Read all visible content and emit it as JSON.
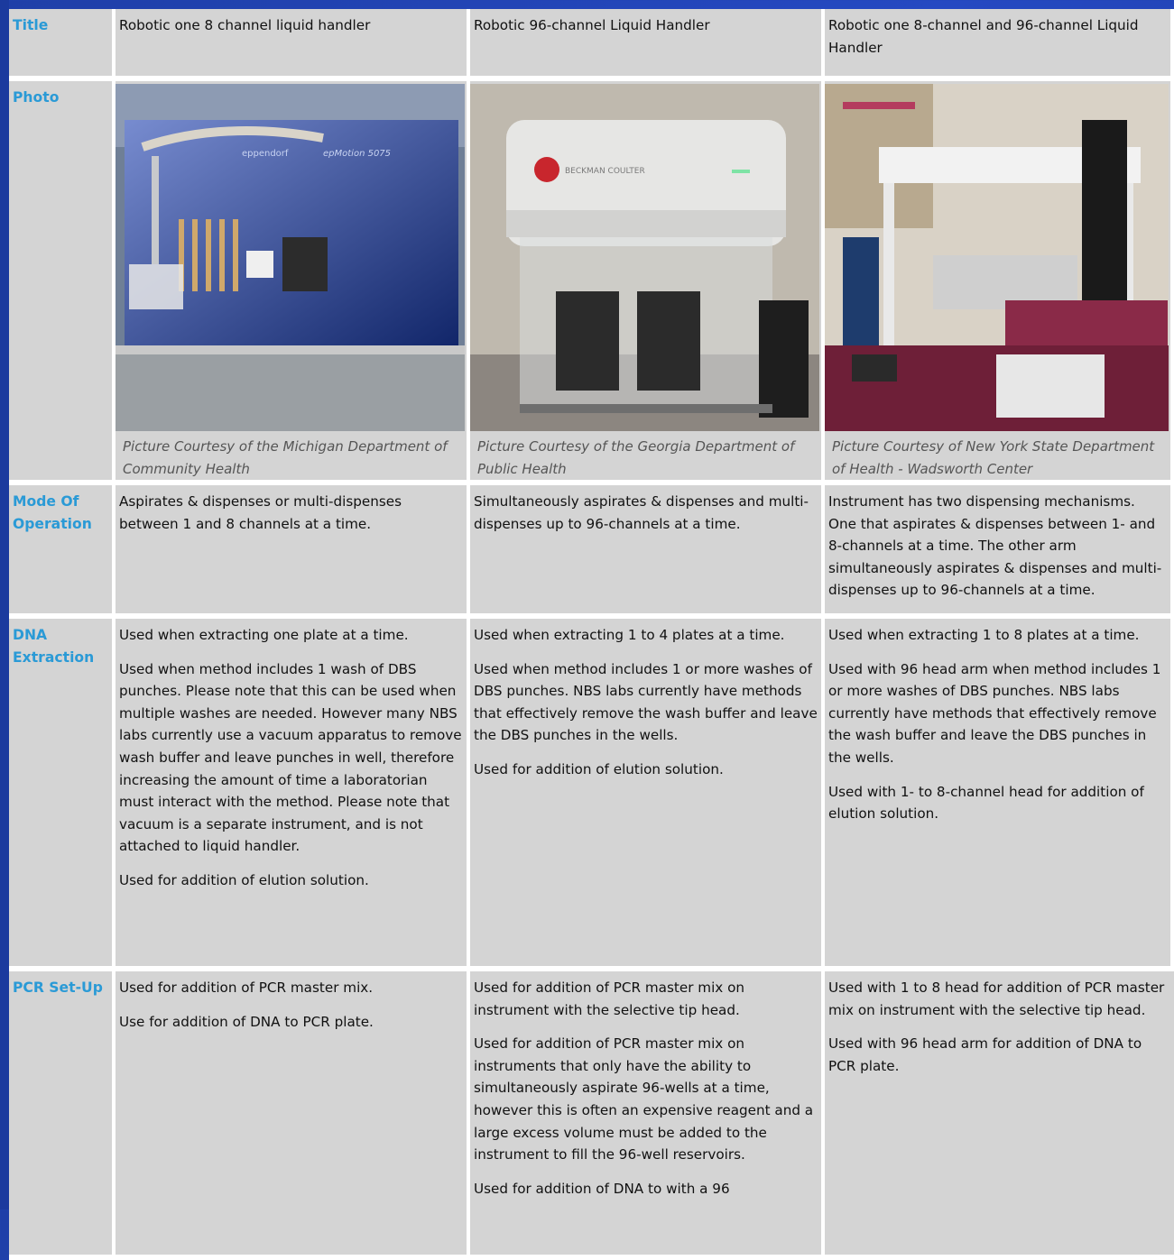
{
  "headers": {
    "title": "Title",
    "photo": "Photo",
    "mode": "Mode Of Operation",
    "dna": "DNA Extraction",
    "pcr": "PCR Set-Up"
  },
  "columns": [
    {
      "title": "Robotic one 8 channel liquid handler",
      "caption": "Picture Courtesy of the Michigan Department of Community Health",
      "photo_labels": [
        "eppendorf",
        "epMotion 5075"
      ],
      "mode": "Aspirates & dispenses or multi-dispenses between 1 and 8 channels at a time.",
      "dna": [
        "Used when extracting one plate at a time.",
        "Used when method includes 1 wash of DBS punches. Please note that this can be used when multiple washes are needed. However many NBS labs currently use a vacuum apparatus to remove wash buffer and leave punches in well, therefore increasing the amount of time a laboratorian must interact with the method. Please note that vacuum is a separate instrument, and is not attached to liquid handler.",
        "Used for addition of elution solution."
      ],
      "pcr": [
        "Used for addition of PCR master mix.",
        "Use for addition of DNA to PCR plate."
      ]
    },
    {
      "title": "Robotic 96-channel Liquid Handler",
      "caption": "Picture Courtesy of the Georgia Department of Public Health",
      "photo_labels": [
        "BECKMAN COULTER"
      ],
      "mode": "Simultaneously aspirates & dispenses and multi-dispenses up to 96-channels at a time.",
      "dna": [
        "Used when extracting 1 to 4 plates at a time.",
        "Used when method includes 1 or more washes of DBS punches. NBS labs currently have methods that effectively remove the wash buffer and leave the DBS punches in the wells.",
        "Used for addition of elution solution."
      ],
      "pcr": [
        "Used for addition of PCR master mix on instrument with the selective tip head.",
        "Used for addition of PCR master mix on instruments that only have the ability to simultaneously aspirate 96-wells at a time, however this is often an expensive reagent and a large excess volume must be added to the instrument to fill the 96-well reservoirs.",
        "Used for addition of DNA to with a 96"
      ]
    },
    {
      "title": "Robotic one 8-channel and 96-channel Liquid Handler",
      "caption": "Picture Courtesy of New York State Department of Health - Wadsworth Center",
      "photo_labels": [],
      "mode": "Instrument has two dispensing mechanisms. One that aspirates & dispenses between 1- and 8-channels at a time. The other arm simultaneously aspirates & dispenses and multi-dispenses up to 96-channels at a time.",
      "dna": [
        "Used when extracting 1 to 8 plates at a time.",
        "Used with 96 head arm when method includes 1 or more washes of DBS punches. NBS labs currently have methods that effectively remove the wash buffer and leave the DBS punches in the wells.",
        "Used with 1- to 8-channel head for addition of elution solution."
      ],
      "pcr": [
        "Used with 1 to 8 head for addition of PCR master mix on instrument with the selective tip head.",
        "Used with 96 head arm for addition of DNA to PCR plate."
      ]
    }
  ]
}
